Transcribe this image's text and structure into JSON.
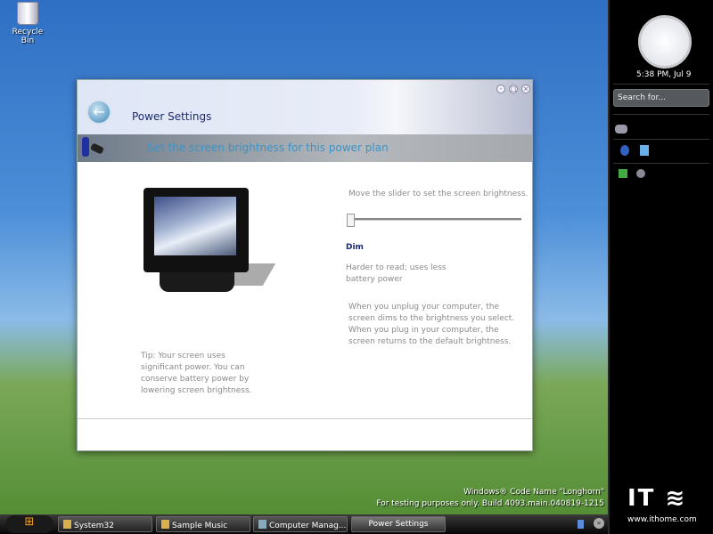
{
  "desktop": {
    "recycle_bin": "Recycle Bin",
    "watermark_line1": "Windows® Code Name \"Longhorn\"",
    "watermark_line2": "For testing purposes only. Build 4093.main.040819-1215"
  },
  "window": {
    "title": "Power Settings",
    "heading": "Set the screen brightness for this power plan",
    "slider_instruction": "Move the slider to set the screen brightness.",
    "brightness_value": 0,
    "level_label": "Dim",
    "level_desc": "Harder to read; uses less battery power",
    "unplug_info": "When you unplug your computer, the screen dims to the brightness you select. When you plug in your computer, the screen returns to the default brightness.",
    "tip": "Tip: Your screen uses significant power. You can conserve battery power by lowering screen brightness."
  },
  "sidebar": {
    "clock_text": "5:38 PM, Jul 9",
    "search_placeholder": "Search for..."
  },
  "taskbar": {
    "items": [
      "System32",
      "Sample Music",
      "Computer Manag...",
      "Power Settings"
    ]
  },
  "logo": {
    "brand": "IT之家",
    "url": "www.ithome.com"
  }
}
